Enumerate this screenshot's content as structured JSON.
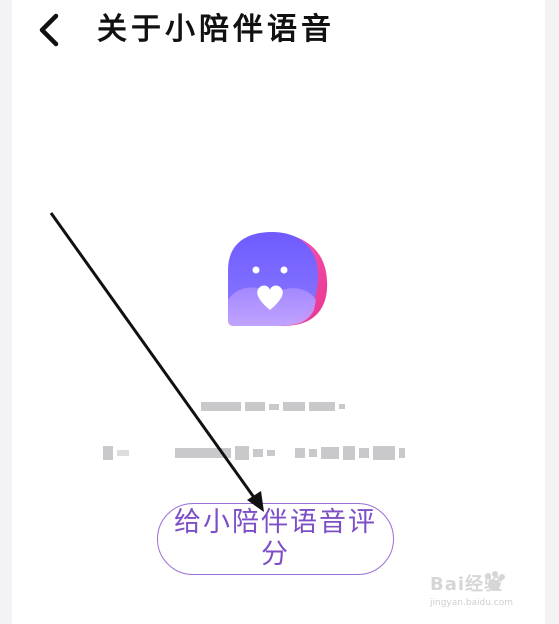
{
  "header": {
    "title": "关于小陪伴语音",
    "back_icon": "chevron-left-icon"
  },
  "app": {
    "logo_icon": "app-logo-heart-bird",
    "colors": {
      "primary": "#7b61ff",
      "accent": "#ff4fb0",
      "button_text": "#7d4fc7"
    }
  },
  "rate_button": {
    "label": "给小陪伴语音评分"
  },
  "watermark": {
    "brand": "Bai经验",
    "url": "jingyan.baidu.com"
  }
}
